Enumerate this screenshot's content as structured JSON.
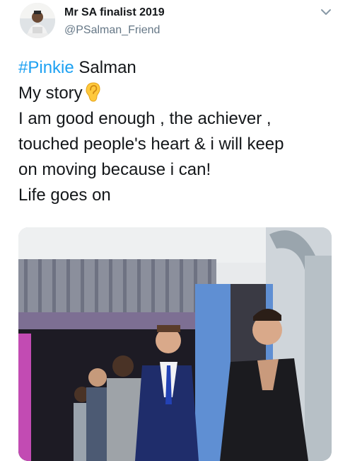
{
  "tweet": {
    "author": {
      "display_name": "Mr SA finalist 2019",
      "handle": "@PSalman_Friend",
      "avatar_icon": "avatar-photo"
    },
    "menu_icon": "chevron-down-icon",
    "text": {
      "hashtag": "#Pinkie",
      "line1_rest": " Salman",
      "line2": "My story",
      "line2_emoji": "ear-emoji",
      "line3": "I am good enough , the achiever ,",
      "line4": "touched people's heart & i will keep",
      "line5": "on moving because i can!",
      "line6": "Life goes on"
    },
    "media": {
      "type": "photo"
    }
  },
  "colors": {
    "hashtag": "#1da1f2",
    "handle": "#657786",
    "text": "#14171a"
  }
}
